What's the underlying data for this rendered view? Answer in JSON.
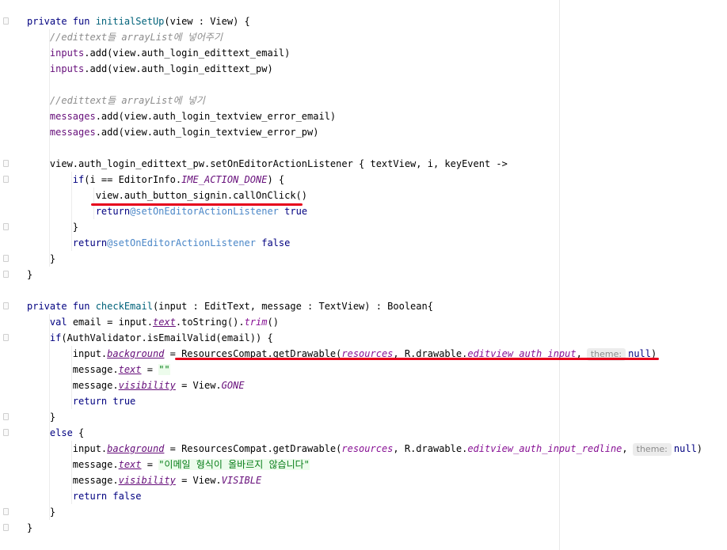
{
  "editor": {
    "lines": [
      [
        {
          "t": "private fun ",
          "c": "kw"
        },
        {
          "t": "initialSetUp",
          "c": "fn"
        },
        {
          "t": "(view : View) {",
          "c": ""
        }
      ],
      [
        {
          "t": "    ",
          "c": ""
        },
        {
          "t": "//edittext들 arrayList에 넣어주기",
          "c": "comment"
        }
      ],
      [
        {
          "t": "    ",
          "c": ""
        },
        {
          "t": "inputs",
          "c": "prop"
        },
        {
          "t": ".add(view.auth_login_edittext_email)",
          "c": ""
        }
      ],
      [
        {
          "t": "    ",
          "c": ""
        },
        {
          "t": "inputs",
          "c": "prop"
        },
        {
          "t": ".add(view.auth_login_edittext_pw)",
          "c": ""
        }
      ],
      [],
      [
        {
          "t": "    ",
          "c": ""
        },
        {
          "t": "//edittext들 arrayList에 넣기",
          "c": "comment"
        }
      ],
      [
        {
          "t": "    ",
          "c": ""
        },
        {
          "t": "messages",
          "c": "prop"
        },
        {
          "t": ".add(view.auth_login_textview_error_email)",
          "c": ""
        }
      ],
      [
        {
          "t": "    ",
          "c": ""
        },
        {
          "t": "messages",
          "c": "prop"
        },
        {
          "t": ".add(view.auth_login_textview_error_pw)",
          "c": ""
        }
      ],
      [],
      [
        {
          "t": "    view.auth_login_edittext_pw.setOnEditorActionListener { textView, i, keyEvent ->",
          "c": ""
        }
      ],
      [
        {
          "t": "        ",
          "c": ""
        },
        {
          "t": "if",
          "c": "kw"
        },
        {
          "t": "(i == EditorInfo.",
          "c": ""
        },
        {
          "t": "IME_ACTION_DONE",
          "c": "const"
        },
        {
          "t": ") {",
          "c": ""
        }
      ],
      [
        {
          "t": "            view.auth_button_signin.callOnClick()",
          "c": ""
        }
      ],
      [
        {
          "t": "            ",
          "c": ""
        },
        {
          "t": "return",
          "c": "kw"
        },
        {
          "t": "@setOnEditorActionListener",
          "c": "label"
        },
        {
          "t": " ",
          "c": ""
        },
        {
          "t": "true",
          "c": "kw"
        }
      ],
      [
        {
          "t": "        }",
          "c": ""
        }
      ],
      [
        {
          "t": "        ",
          "c": ""
        },
        {
          "t": "return",
          "c": "kw"
        },
        {
          "t": "@setOnEditorActionListener",
          "c": "label"
        },
        {
          "t": " ",
          "c": ""
        },
        {
          "t": "false",
          "c": "kw"
        }
      ],
      [
        {
          "t": "    }",
          "c": ""
        }
      ],
      [
        {
          "t": "}",
          "c": ""
        }
      ],
      [],
      [
        {
          "t": "private fun ",
          "c": "kw"
        },
        {
          "t": "checkEmail",
          "c": "fn"
        },
        {
          "t": "(input : EditText, message : TextView) : Boolean{",
          "c": ""
        }
      ],
      [
        {
          "t": "    ",
          "c": ""
        },
        {
          "t": "val ",
          "c": "kw"
        },
        {
          "t": "email = input.",
          "c": ""
        },
        {
          "t": "text",
          "c": "ext"
        },
        {
          "t": ".toString().",
          "c": ""
        },
        {
          "t": "trim",
          "c": "param"
        },
        {
          "t": "()",
          "c": ""
        }
      ],
      [
        {
          "t": "    ",
          "c": ""
        },
        {
          "t": "if",
          "c": "kw"
        },
        {
          "t": "(AuthValidator.isEmailValid(email)) {",
          "c": ""
        }
      ],
      [
        {
          "t": "        input.",
          "c": ""
        },
        {
          "t": "background",
          "c": "ext"
        },
        {
          "t": " = ResourcesCompat.getDrawable(",
          "c": ""
        },
        {
          "t": "resources",
          "c": "param"
        },
        {
          "t": ", R.drawable.",
          "c": ""
        },
        {
          "t": "editview_auth_input",
          "c": "param"
        },
        {
          "t": ",",
          "c": ""
        },
        {
          "t": "theme:",
          "c": "hint"
        },
        {
          "t": "null",
          "c": "kw"
        },
        {
          "t": ")",
          "c": ""
        }
      ],
      [
        {
          "t": "        message.",
          "c": ""
        },
        {
          "t": "text",
          "c": "ext"
        },
        {
          "t": " = ",
          "c": ""
        },
        {
          "t": "\"\"",
          "c": "str"
        }
      ],
      [
        {
          "t": "        message.",
          "c": ""
        },
        {
          "t": "visibility",
          "c": "ext"
        },
        {
          "t": " = View.",
          "c": ""
        },
        {
          "t": "GONE",
          "c": "const"
        }
      ],
      [
        {
          "t": "        ",
          "c": ""
        },
        {
          "t": "return true",
          "c": "kw"
        }
      ],
      [
        {
          "t": "    }",
          "c": ""
        }
      ],
      [
        {
          "t": "    ",
          "c": ""
        },
        {
          "t": "else",
          "c": "kw"
        },
        {
          "t": " {",
          "c": ""
        }
      ],
      [
        {
          "t": "        input.",
          "c": ""
        },
        {
          "t": "background",
          "c": "ext"
        },
        {
          "t": " = ResourcesCompat.getDrawable(",
          "c": ""
        },
        {
          "t": "resources",
          "c": "param"
        },
        {
          "t": ", R.drawable.",
          "c": ""
        },
        {
          "t": "editview_auth_input_redline",
          "c": "param"
        },
        {
          "t": ",",
          "c": ""
        },
        {
          "t": "theme:",
          "c": "hint"
        },
        {
          "t": "null",
          "c": "kw"
        },
        {
          "t": ")",
          "c": ""
        }
      ],
      [
        {
          "t": "        message.",
          "c": ""
        },
        {
          "t": "text",
          "c": "ext"
        },
        {
          "t": " = ",
          "c": ""
        },
        {
          "t": "\"이메일 형식이 올바르지 않습니다\"",
          "c": "str"
        }
      ],
      [
        {
          "t": "        message.",
          "c": ""
        },
        {
          "t": "visibility",
          "c": "ext"
        },
        {
          "t": " = View.",
          "c": ""
        },
        {
          "t": "VISIBLE",
          "c": "const"
        }
      ],
      [
        {
          "t": "        ",
          "c": ""
        },
        {
          "t": "return false",
          "c": "kw"
        }
      ],
      [
        {
          "t": "    }",
          "c": ""
        }
      ],
      [
        {
          "t": "}",
          "c": ""
        }
      ]
    ]
  },
  "colors": {
    "background": "#ffffff",
    "keyword": "#000080",
    "function": "#00627a",
    "property": "#660e7a",
    "comment": "#8c8c8c",
    "string": "#067d17",
    "annotation_underline": "#e6001b"
  }
}
